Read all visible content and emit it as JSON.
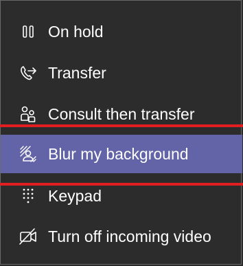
{
  "menu": {
    "items": [
      {
        "label": "On hold",
        "icon": "pause-icon"
      },
      {
        "label": "Transfer",
        "icon": "phone-transfer-icon"
      },
      {
        "label": "Consult then transfer",
        "icon": "people-consult-icon"
      },
      {
        "label": "Blur my background",
        "icon": "blur-background-icon"
      },
      {
        "label": "Keypad",
        "icon": "keypad-icon"
      },
      {
        "label": "Turn off incoming video",
        "icon": "video-off-icon"
      }
    ],
    "highlighted_index": 3,
    "highlight_color": "#6264a7",
    "annotation_color": "#e21e23"
  }
}
